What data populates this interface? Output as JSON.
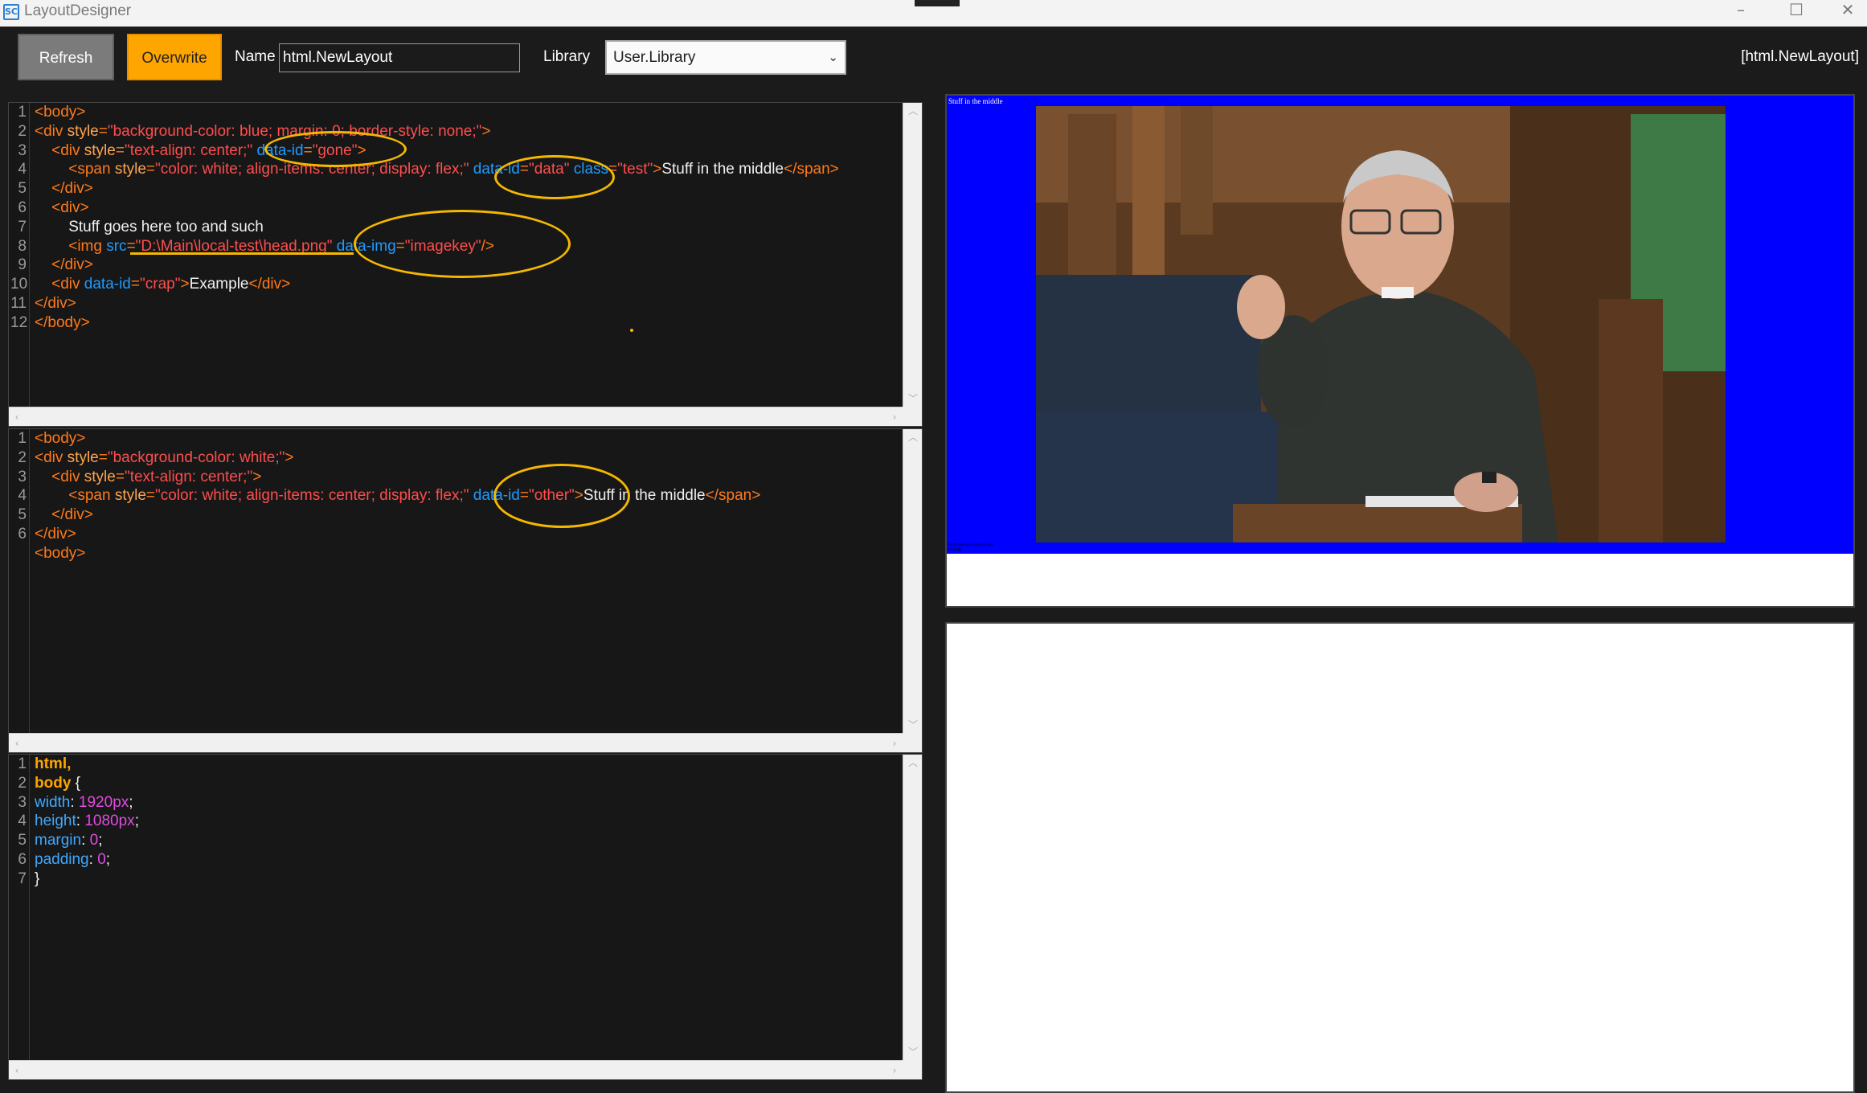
{
  "window": {
    "title": "LayoutDesigner",
    "app_icon": "SC",
    "controls": [
      "–",
      "☐",
      "✕"
    ]
  },
  "toolbar": {
    "refresh_label": "Refresh",
    "overwrite_label": "Overwrite",
    "name_label": "Name",
    "name_value": "html.NewLayout",
    "library_label": "Library",
    "library_value": "User.Library",
    "current_layout": "[html.NewLayout]"
  },
  "editor1": {
    "line_numbers": [
      "1",
      "2",
      "3",
      "4",
      "5",
      "6",
      "7",
      "8",
      "9",
      "10",
      "11",
      "12"
    ],
    "lines": [
      [
        [
          "t",
          "<body>"
        ]
      ],
      [
        [
          "t",
          "<div "
        ],
        [
          "a",
          "style"
        ],
        [
          "t",
          "="
        ],
        [
          "v",
          "\"background-color: blue; margin: 0; border-style: none;\""
        ],
        [
          "t",
          ">"
        ]
      ],
      [
        [
          "t",
          "    <div "
        ],
        [
          "a",
          "style"
        ],
        [
          "t",
          "="
        ],
        [
          "v",
          "\"text-align: center;\""
        ],
        [
          "da",
          " data-id"
        ],
        [
          "t",
          "="
        ],
        [
          "v",
          "\"gone\""
        ],
        [
          "t",
          ">"
        ]
      ],
      [
        [
          "t",
          "        <span "
        ],
        [
          "a",
          "style"
        ],
        [
          "t",
          "="
        ],
        [
          "v",
          "\"color: white; align-items: center; display: flex;\""
        ],
        [
          "da",
          " data-id"
        ],
        [
          "t",
          "="
        ],
        [
          "v",
          "\"data\""
        ],
        [
          "da",
          " class"
        ],
        [
          "t",
          "="
        ],
        [
          "v",
          "\"test\""
        ],
        [
          "t",
          ">"
        ],
        [
          "w",
          "Stuff in the middle"
        ],
        [
          "t",
          "</span>"
        ]
      ],
      [
        [
          "t",
          "    </div>"
        ]
      ],
      [
        [
          "t",
          "    <div>"
        ]
      ],
      [
        [
          "w",
          "        Stuff goes here too and such"
        ]
      ],
      [
        [
          "t",
          "        <img "
        ],
        [
          "da",
          "src"
        ],
        [
          "t",
          "="
        ],
        [
          "v",
          "\"D:\\Main\\local-test\\head.png\""
        ],
        [
          "da",
          " data-img"
        ],
        [
          "t",
          "="
        ],
        [
          "v",
          "\"imagekey\""
        ],
        [
          "t",
          "/>"
        ]
      ],
      [
        [
          "t",
          "    </div>"
        ]
      ],
      [
        [
          "t",
          "    <div "
        ],
        [
          "da",
          "data-id"
        ],
        [
          "t",
          "="
        ],
        [
          "v",
          "\"crap\""
        ],
        [
          "t",
          ">"
        ],
        [
          "w",
          "Example"
        ],
        [
          "t",
          "</div>"
        ]
      ],
      [
        [
          "t",
          "</div>"
        ]
      ],
      [
        [
          "t",
          "</body>"
        ]
      ]
    ]
  },
  "editor2": {
    "line_numbers": [
      "1",
      "2",
      "3",
      "4",
      "5",
      "6"
    ],
    "lines": [
      [
        [
          "t",
          "<body>"
        ]
      ],
      [
        [
          "t",
          "<div "
        ],
        [
          "a",
          "style"
        ],
        [
          "t",
          "="
        ],
        [
          "v",
          "\"background-color: white;\""
        ],
        [
          "t",
          ">"
        ]
      ],
      [
        [
          "t",
          "    <div "
        ],
        [
          "a",
          "style"
        ],
        [
          "t",
          "="
        ],
        [
          "v",
          "\"text-align: center;\""
        ],
        [
          "t",
          ">"
        ]
      ],
      [
        [
          "t",
          "        <span "
        ],
        [
          "a",
          "style"
        ],
        [
          "t",
          "="
        ],
        [
          "v",
          "\"color: white; align-items: center; display: flex;\""
        ],
        [
          "da",
          " data-id"
        ],
        [
          "t",
          "="
        ],
        [
          "v",
          "\"other\""
        ],
        [
          "t",
          ">"
        ],
        [
          "w",
          "Stuff in the middle"
        ],
        [
          "t",
          "</span>"
        ]
      ],
      [
        [
          "t",
          "    </div>"
        ]
      ],
      [
        [
          "t",
          "</div>"
        ]
      ],
      [
        [
          "t",
          "<body>"
        ]
      ]
    ]
  },
  "editor3": {
    "line_numbers": [
      "1",
      "2",
      "3",
      "4",
      "5",
      "6",
      "7"
    ],
    "lines": [
      [
        [
          "yel",
          "html,"
        ]
      ],
      [
        [
          "yel",
          "body"
        ],
        [
          "w",
          " {"
        ]
      ],
      [
        [
          "blu",
          "width"
        ],
        [
          "w",
          ": "
        ],
        [
          "mag",
          "1920px"
        ],
        [
          "w",
          ";"
        ]
      ],
      [
        [
          "blu",
          "height"
        ],
        [
          "w",
          ": "
        ],
        [
          "mag",
          "1080px"
        ],
        [
          "w",
          ";"
        ]
      ],
      [
        [
          "blu",
          "margin"
        ],
        [
          "w",
          ": "
        ],
        [
          "mag",
          "0"
        ],
        [
          "w",
          ";"
        ]
      ],
      [
        [
          "blu",
          "padding"
        ],
        [
          "w",
          ": "
        ],
        [
          "mag",
          "0"
        ],
        [
          "w",
          ";"
        ]
      ],
      [
        [
          "w",
          "}"
        ]
      ]
    ]
  },
  "preview": {
    "top_text": "Stuff in the middle",
    "bottom_text_1": "Stuff goes here too and such",
    "bottom_text_2": "Example",
    "background": "#0000ff"
  },
  "colors": {
    "accent": "#ffa500",
    "annotation": "#f5b800",
    "tag": "#ff7a1a",
    "value": "#ff4d4d",
    "attr": "#1e9bff"
  }
}
